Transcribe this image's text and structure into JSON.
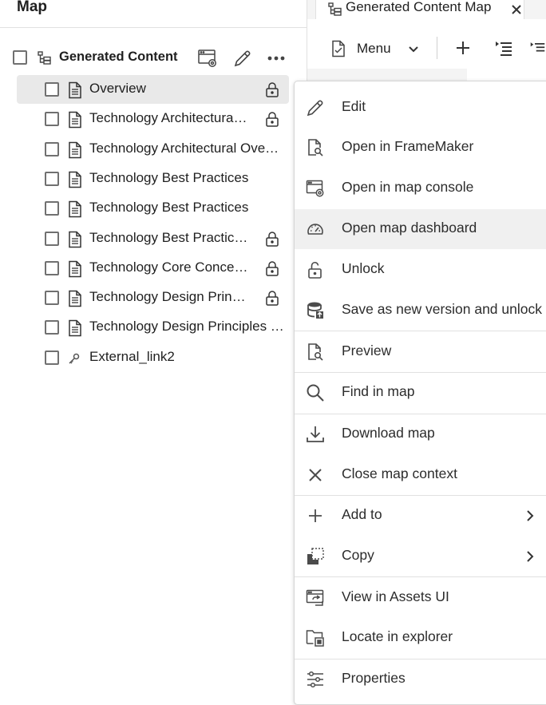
{
  "left_panel": {
    "title": "Map",
    "root": {
      "label": "Generated Content Map"
    },
    "items": [
      {
        "label": "Overview",
        "icon": "document-icon",
        "locked": true,
        "selected": true
      },
      {
        "label": "Technology Architectura…",
        "icon": "document-icon",
        "locked": true
      },
      {
        "label": "Technology Architectural Ove…",
        "icon": "document-icon",
        "locked": false
      },
      {
        "label": "Technology Best Practices",
        "icon": "document-icon",
        "locked": false
      },
      {
        "label": "Technology Best Practices",
        "icon": "document-icon",
        "locked": false
      },
      {
        "label": "Technology Best Practic…",
        "icon": "document-icon",
        "locked": true
      },
      {
        "label": "Technology Core Conce…",
        "icon": "document-icon",
        "locked": true
      },
      {
        "label": "Technology Design Prin…",
        "icon": "document-icon",
        "locked": true
      },
      {
        "label": "Technology Design Principles …",
        "icon": "document-icon",
        "locked": false
      },
      {
        "label": "External_link2",
        "icon": "link-icon",
        "locked": false
      }
    ]
  },
  "tab": {
    "label": "Generated Content Map"
  },
  "toolbar": {
    "menu_label": "Menu"
  },
  "context_menu": {
    "items": [
      {
        "label": "Edit",
        "icon": "pencil-icon"
      },
      {
        "label": "Open in FrameMaker",
        "icon": "document-search-icon"
      },
      {
        "label": "Open in map console",
        "icon": "map-console-icon"
      },
      {
        "label": "Open map dashboard",
        "icon": "dashboard-gauge-icon",
        "hover": true
      },
      {
        "label": "Unlock",
        "icon": "unlock-icon"
      },
      {
        "label": "Save as new version and unlock",
        "icon": "save-version-icon"
      },
      {
        "label": "Preview",
        "icon": "preview-icon"
      },
      {
        "label": "Find in map",
        "icon": "search-icon"
      },
      {
        "label": "Download map",
        "icon": "download-icon"
      },
      {
        "label": "Close map context",
        "icon": "close-icon"
      },
      {
        "label": "Add to",
        "icon": "add-icon",
        "submenu": true
      },
      {
        "label": "Copy",
        "icon": "copy-icon",
        "submenu": true
      },
      {
        "label": "View in Assets UI",
        "icon": "assets-ui-icon"
      },
      {
        "label": "Locate in explorer",
        "icon": "locate-folder-icon"
      },
      {
        "label": "Properties",
        "icon": "properties-sliders-icon"
      }
    ]
  },
  "colors": {
    "selected_row": "#e9e9e9",
    "menu_hover": "#f0f0f0",
    "text": "#1f1f1f",
    "icon": "#4b4b4b"
  }
}
